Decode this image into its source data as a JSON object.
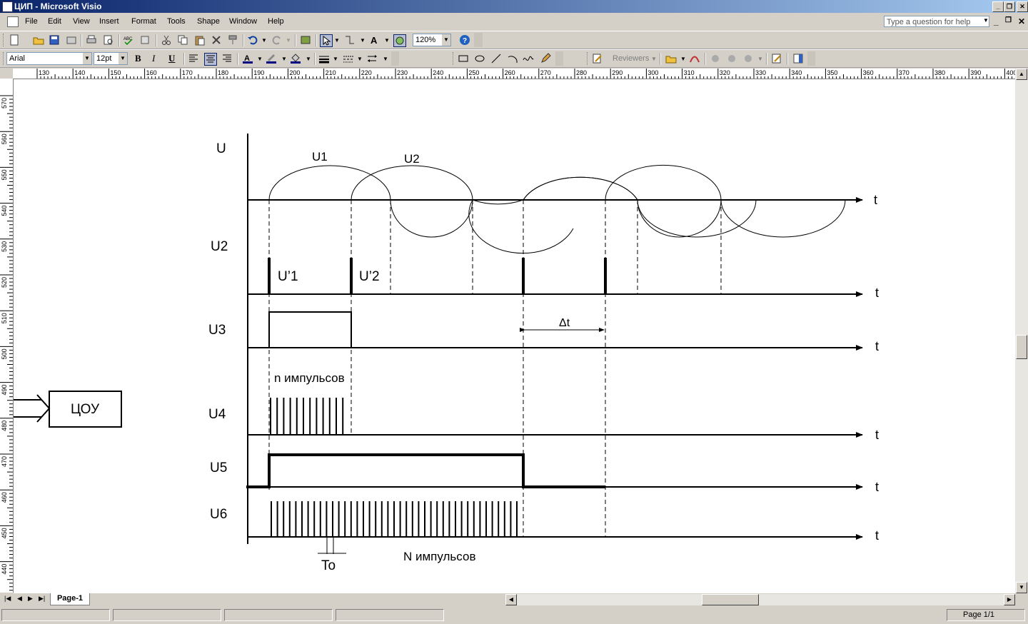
{
  "window": {
    "title": "ЦИП - Microsoft Visio"
  },
  "menu": {
    "items": [
      "File",
      "Edit",
      "View",
      "Insert",
      "Format",
      "Tools",
      "Shape",
      "Window",
      "Help"
    ]
  },
  "help_box": {
    "placeholder": "Type a question for help"
  },
  "toolbar": {
    "zoom": "120%",
    "font": "Arial",
    "font_size": "12pt",
    "reviewers_label": "Reviewers",
    "bold": "B",
    "italic": "I",
    "underline": "U"
  },
  "ruler": {
    "h_ticks": [
      "130",
      "140",
      "150",
      "160",
      "170",
      "180",
      "190",
      "200",
      "210",
      "220",
      "230",
      "240",
      "250",
      "260",
      "270",
      "280",
      "290",
      "300",
      "310",
      "320",
      "330",
      "340",
      "350",
      "360",
      "370",
      "380",
      "390",
      "400"
    ],
    "v_ticks": [
      "570",
      "560",
      "550",
      "540",
      "530",
      "520",
      "510",
      "500",
      "490",
      "480",
      "470",
      "460",
      "450",
      "440"
    ]
  },
  "drawing": {
    "block_label": "ЦОУ",
    "axis_labels": [
      "U",
      "U2",
      "U3",
      "U4",
      "U5",
      "U6"
    ],
    "time_label": "t",
    "wave_labels": [
      "U1",
      "U2"
    ],
    "pulse_labels": [
      "U’1",
      "U’2"
    ],
    "delta_label": "Δt",
    "n_pulses_label": "n импульсов",
    "N_pulses_label": "N импульсов",
    "period_label": "To"
  },
  "tabs": {
    "page": "Page-1"
  },
  "status": {
    "page": "Page 1/1"
  }
}
